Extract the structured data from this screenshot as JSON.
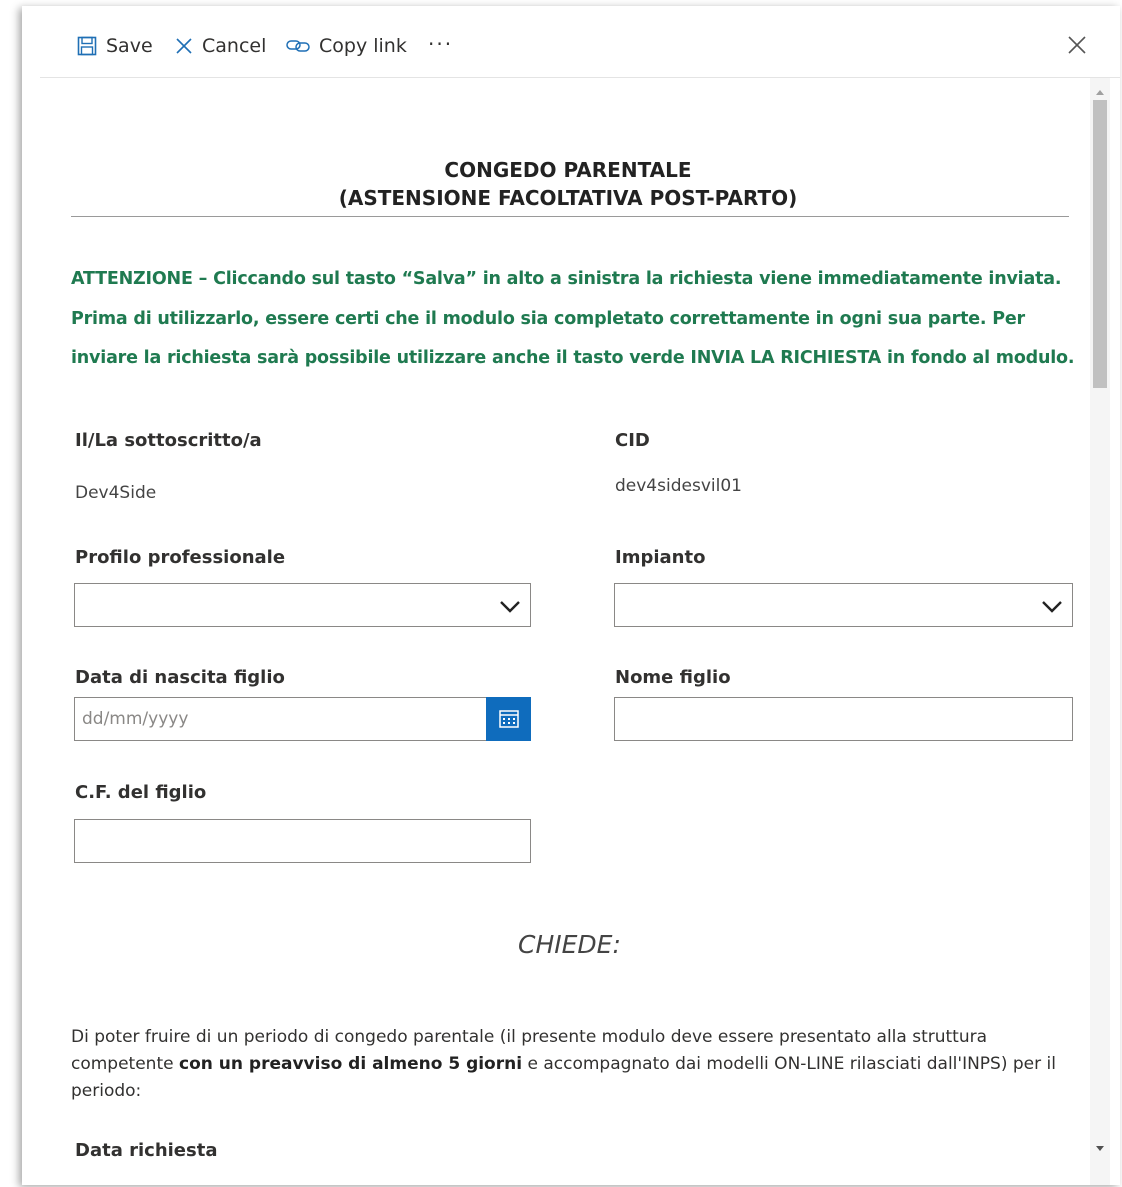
{
  "toolbar": {
    "save_label": "Save",
    "cancel_label": "Cancel",
    "copy_link_label": "Copy link",
    "more_label": "···"
  },
  "form": {
    "title_line1": "CONGEDO PARENTALE",
    "title_line2": "(ASTENSIONE FACOLTATIVA POST-PARTO)",
    "notice_lines": [
      "ATTENZIONE – Cliccando sul tasto “Salva” in alto a sinistra la richiesta viene immediatamente inviata.",
      "Prima di utilizzarlo, essere certi che il modulo sia completato correttamente in ogni sua parte. Per",
      "inviare la richiesta sarà possibile utilizzare anche il tasto verde INVIA LA RICHIESTA in fondo al modulo."
    ],
    "fields": {
      "sottoscritto": {
        "label": "Il/La sottoscritto/a",
        "value": "Dev4Side"
      },
      "cid": {
        "label": "CID",
        "value": "dev4sidesvil01"
      },
      "profilo": {
        "label": "Profilo professionale",
        "value": ""
      },
      "impianto": {
        "label": "Impianto",
        "value": ""
      },
      "data_nascita": {
        "label": "Data di nascita figlio",
        "value": "",
        "placeholder": "dd/mm/yyyy"
      },
      "nome_figlio": {
        "label": "Nome figlio",
        "value": ""
      },
      "cf_figlio": {
        "label": "C.F. del figlio",
        "value": ""
      }
    },
    "chiede": "CHIEDE:",
    "paragraph": {
      "part1": "Di poter fruire di un periodo di congedo parentale (il presente modulo deve essere presentato alla struttura competente ",
      "bold": "con un preavviso di almeno 5 giorni",
      "part2": " e accompagnato dai modelli ON-LINE rilasciati dall'INPS) per il periodo:"
    },
    "data_richiesta_label": "Data richiesta"
  },
  "colors": {
    "notice_green": "#1f7a50",
    "accent_blue": "#0f6cbd"
  }
}
